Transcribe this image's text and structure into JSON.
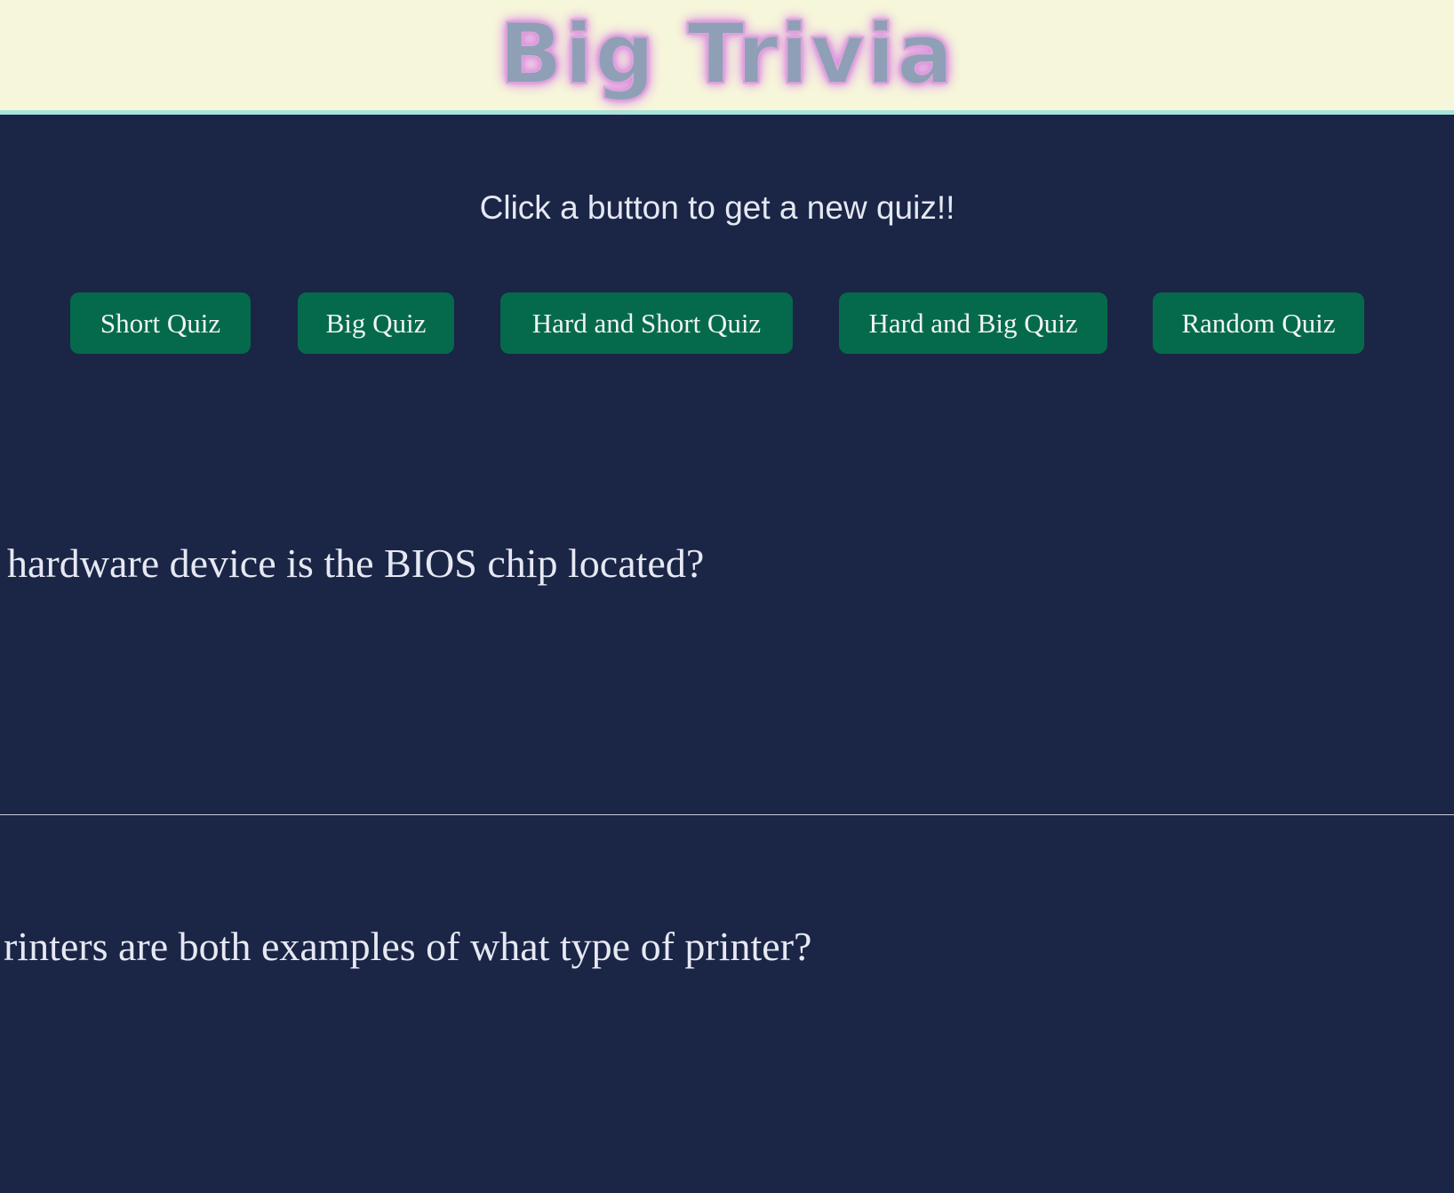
{
  "header": {
    "title": "Big Trivia"
  },
  "main": {
    "prompt": "Click a button to get a new quiz!!",
    "buttons": [
      {
        "label": "Short Quiz"
      },
      {
        "label": "Big Quiz"
      },
      {
        "label": "Hard and Short Quiz"
      },
      {
        "label": "Hard and Big Quiz"
      },
      {
        "label": "Random Quiz"
      }
    ],
    "questions": [
      {
        "text": "hardware device is the BIOS chip located?"
      },
      {
        "text": "rinters are both examples of what type of printer?"
      }
    ]
  },
  "colors": {
    "header_bg": "#f6f7da",
    "header_border": "#a9e4da",
    "page_bg": "#1b2546",
    "button_bg": "#056a4c",
    "title_fill": "#8fa0b6",
    "title_glow": "#e07fe0"
  }
}
